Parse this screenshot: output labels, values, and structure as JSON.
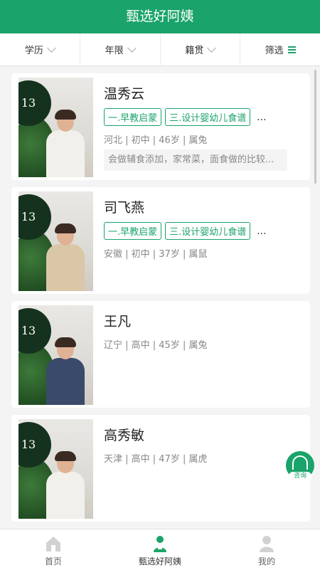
{
  "header": {
    "title": "甄选好阿姨"
  },
  "filters": [
    {
      "label": "学历"
    },
    {
      "label": "年限"
    },
    {
      "label": "籍贯"
    },
    {
      "label": "筛选"
    }
  ],
  "nannies": [
    {
      "name": "温秀云",
      "tags": [
        "一.早教启蒙",
        "三.设计婴幼儿食谱"
      ],
      "more": "...",
      "info": "河北 | 初中 | 46岁 | 属兔",
      "desc": "会做辅食添加，家常菜，面食做的比较...",
      "photo_badge": "13"
    },
    {
      "name": "司飞燕",
      "tags": [
        "一.早教启蒙",
        "三.设计婴幼儿食谱"
      ],
      "more": "...",
      "info": "安徽 | 初中 | 37岁 | 属鼠",
      "desc": "",
      "photo_badge": "13"
    },
    {
      "name": "王凡",
      "tags": [],
      "more": "",
      "info": "辽宁 | 高中 | 45岁 | 属兔",
      "desc": "",
      "photo_badge": "13"
    },
    {
      "name": "高秀敏",
      "tags": [],
      "more": "",
      "info": "天津 | 高中 | 47岁 | 属虎",
      "desc": "",
      "photo_badge": "13"
    }
  ],
  "consult": {
    "label": "咨询"
  },
  "tabbar": {
    "items": [
      {
        "label": "首页",
        "icon": "home-icon"
      },
      {
        "label": "甄选好阿姨",
        "icon": "nanny-icon"
      },
      {
        "label": "我的",
        "icon": "user-icon"
      }
    ],
    "active_index": 1
  },
  "colors": {
    "brand": "#1aa36a"
  }
}
